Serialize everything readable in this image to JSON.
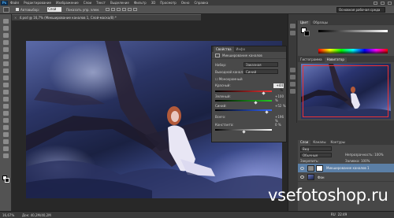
{
  "app": {
    "logo": "Ps"
  },
  "menu": [
    "Файл",
    "Редактирование",
    "Изображение",
    "Слои",
    "Текст",
    "Выделение",
    "Фильтр",
    "3D",
    "Просмотр",
    "Окно",
    "Справка"
  ],
  "options_bar": {
    "autoselect_label": "Автовыбор:",
    "autoselect_value": "Слой",
    "show_controls": "Показать упр. элем.",
    "workspace": "Основная рабочая среда"
  },
  "document": {
    "tab_title": "4.psd @ 16,7% (Микширование каналов 1, Слой-маска/8) *",
    "close_glyph": "×"
  },
  "properties": {
    "tab_properties": "Свойства",
    "tab_info": "Инфо",
    "title": "Микширование каналов",
    "preset_label": "Набор:",
    "preset_value": "Заказная",
    "output_label": "Выходной канал:",
    "output_value": "Синий",
    "monochrome": "Монохромный",
    "channels": [
      {
        "label": "Красный:",
        "value": "+44 %",
        "level": 0.86
      },
      {
        "label": "Зеленый:",
        "value": "+100 %",
        "level": 0.72
      },
      {
        "label": "Синий:",
        "value": "+52 %",
        "level": 0.92
      },
      {
        "label": "Всего:",
        "value": "+196 %",
        "level": 0.5
      },
      {
        "label": "Константа:",
        "value": "0 %",
        "level": 0.5
      }
    ]
  },
  "color_panel": {
    "tabs": [
      "Цвет",
      "Образцы"
    ],
    "hex": "#ffffff"
  },
  "nav_panel": {
    "tabs": [
      "Гистограмма",
      "Навигатор"
    ]
  },
  "layers_panel": {
    "tabs": [
      "Слои",
      "Каналы",
      "Контуры"
    ],
    "kind": "Вид",
    "blend": "Обычные",
    "opacity": "Непрозрачность: 100%",
    "fill": "Заливка: 100%",
    "lock": "Закрепить:",
    "layers": [
      {
        "name": "Микширование каналов 1"
      },
      {
        "name": "Фон"
      }
    ]
  },
  "status": {
    "zoom": "16,67%",
    "docinfo": "Док: 40,2M/40,2M"
  },
  "taskbar": [
    "RU",
    "22:49"
  ],
  "watermark": "vsefotoshop.ru"
}
